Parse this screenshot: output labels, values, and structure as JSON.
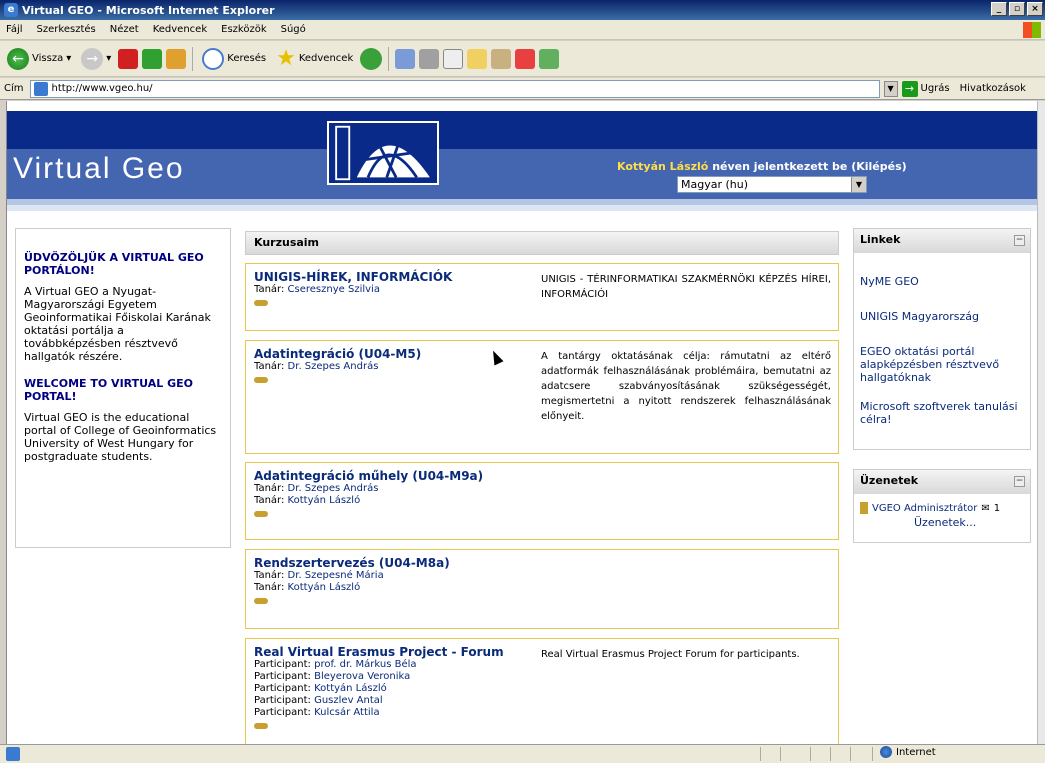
{
  "window": {
    "title": "Virtual GEO - Microsoft Internet Explorer"
  },
  "menu": [
    "Fájl",
    "Szerkesztés",
    "Nézet",
    "Kedvencek",
    "Eszközök",
    "Súgó"
  ],
  "toolbar": {
    "back": "Vissza",
    "search": "Keresés",
    "favorites": "Kedvencek"
  },
  "address": {
    "label": "Cím",
    "url": "http://www.vgeo.hu/",
    "go": "Ugrás",
    "links": "Hivatkozások"
  },
  "site": {
    "title": "Virtual Geo",
    "login_name": "Kottyán László",
    "login_text": " néven jelentkezett be (",
    "logout": "Kilépés",
    "login_close": ")",
    "language": "Magyar (hu)"
  },
  "welcome": {
    "heading_hu": "ÜDVÖZÖLJÜK A VIRTUAL GEO PORTÁLON!",
    "text_hu": "A Virtual GEO a Nyugat-Magyarországi Egyetem Geoinformatikai Főiskolai Karának oktatási portálja a továbbképzésben résztvevő hallgatók részére.",
    "heading_en": "WELCOME TO VIRTUAL GEO PORTAL!",
    "text_en": "Virtual GEO is the educational portal of College of Geoinformatics University of West Hungary for postgraduate students."
  },
  "courses": {
    "header": "Kurzusaim",
    "items": [
      {
        "title": "UNIGIS-HÍREK, INFORMÁCIÓK",
        "teachers": [
          {
            "role": "Tanár:",
            "name": "Cseresznye Szilvia"
          }
        ],
        "summary": "UNIGIS - TÉRINFORMATIKAI SZAKMÉRNÖKI KÉPZÉS HÍREI, INFORMÁCIÓI"
      },
      {
        "title": "Adatintegráció (U04-M5)",
        "teachers": [
          {
            "role": "Tanár:",
            "name": "Dr. Szepes András"
          }
        ],
        "summary": "A tantárgy oktatásának célja: rámutatni az eltérő adatformák felhasználásának problémáira, bemutatni az adatcsere szabványosításának szükségességét, megismertetni a nyitott rendszerek felhasználásának előnyeit."
      },
      {
        "title": "Adatintegráció műhely (U04-M9a)",
        "teachers": [
          {
            "role": "Tanár:",
            "name": "Dr. Szepes András"
          },
          {
            "role": "Tanár:",
            "name": "Kottyán László"
          }
        ],
        "summary": ""
      },
      {
        "title": "Rendszertervezés (U04-M8a)",
        "teachers": [
          {
            "role": "Tanár:",
            "name": "Dr. Szepesné Mária"
          },
          {
            "role": "Tanár:",
            "name": "Kottyán László"
          }
        ],
        "summary": ""
      },
      {
        "title": "Real Virtual Erasmus Project - Forum",
        "teachers": [
          {
            "role": "Participant:",
            "name": "prof. dr. Márkus Béla"
          },
          {
            "role": "Participant:",
            "name": "Bleyerova Veronika"
          },
          {
            "role": "Participant:",
            "name": "Kottyán László"
          },
          {
            "role": "Participant:",
            "name": "Guszlev Antal"
          },
          {
            "role": "Participant:",
            "name": "Kulcsár Attila"
          }
        ],
        "summary": "Real Virtual Erasmus Project Forum for participants."
      }
    ]
  },
  "links": {
    "header": "Linkek",
    "items": [
      "NyME GEO",
      "UNIGIS Magyarország",
      "EGEO oktatási portál alapképzésben résztvevő hallgatóknak",
      "Microsoft szoftverek tanulási célra!"
    ]
  },
  "messages": {
    "header": "Üzenetek",
    "sender": "VGEO Adminisztrátor",
    "count": "1",
    "more": "Üzenetek..."
  },
  "status": {
    "zone": "Internet"
  }
}
